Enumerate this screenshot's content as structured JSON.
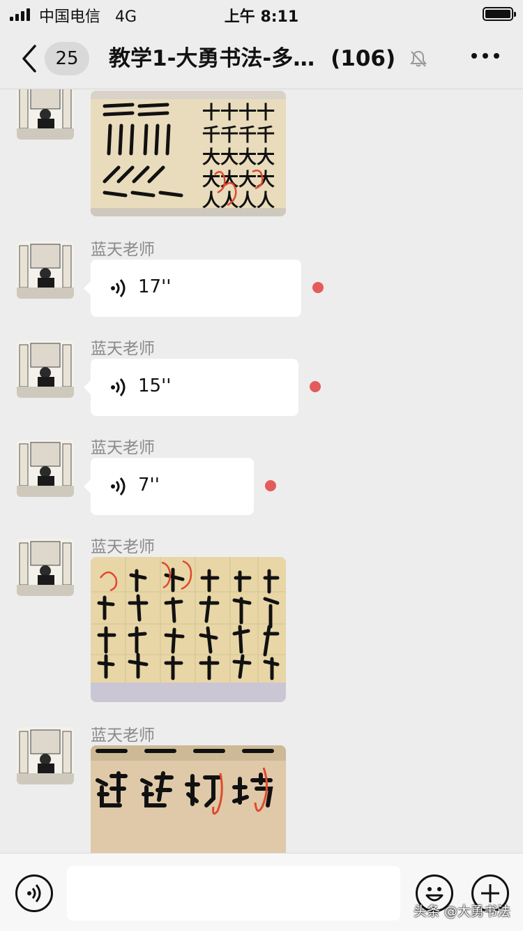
{
  "status_bar": {
    "carrier": "中国电信",
    "network": "4G",
    "time": "上午 8:11",
    "signal_icon": "signal-bars-icon",
    "battery_icon": "battery-icon"
  },
  "nav": {
    "back_icon": "chevron-left-icon",
    "unread_count": "25",
    "title": "教学1-大勇书法-多…",
    "member_count": "(106)",
    "mute_icon": "bell-muted-icon",
    "more_icon": "more-dots-icon"
  },
  "messages": [
    {
      "type": "image",
      "sender": "",
      "image_desc": "calligraphy-strokes-practice"
    },
    {
      "type": "voice",
      "sender": "蓝天老师",
      "duration": "17''",
      "unread": true
    },
    {
      "type": "voice",
      "sender": "蓝天老师",
      "duration": "15''",
      "unread": true
    },
    {
      "type": "voice",
      "sender": "蓝天老师",
      "duration": "7''",
      "unread": true
    },
    {
      "type": "image",
      "sender": "蓝天老师",
      "image_desc": "calligraphy-poem-practice"
    },
    {
      "type": "image",
      "sender": "蓝天老师",
      "image_desc": "calligraphy-characters-closeup"
    }
  ],
  "input_bar": {
    "voice_icon": "voice-input-icon",
    "text_value": "",
    "emoji_icon": "emoji-icon",
    "plus_icon": "plus-icon"
  },
  "watermark": "头条 @大勇书法",
  "colors": {
    "background": "#ededed",
    "unread_dot": "#e35b5b",
    "bubble": "#ffffff"
  }
}
